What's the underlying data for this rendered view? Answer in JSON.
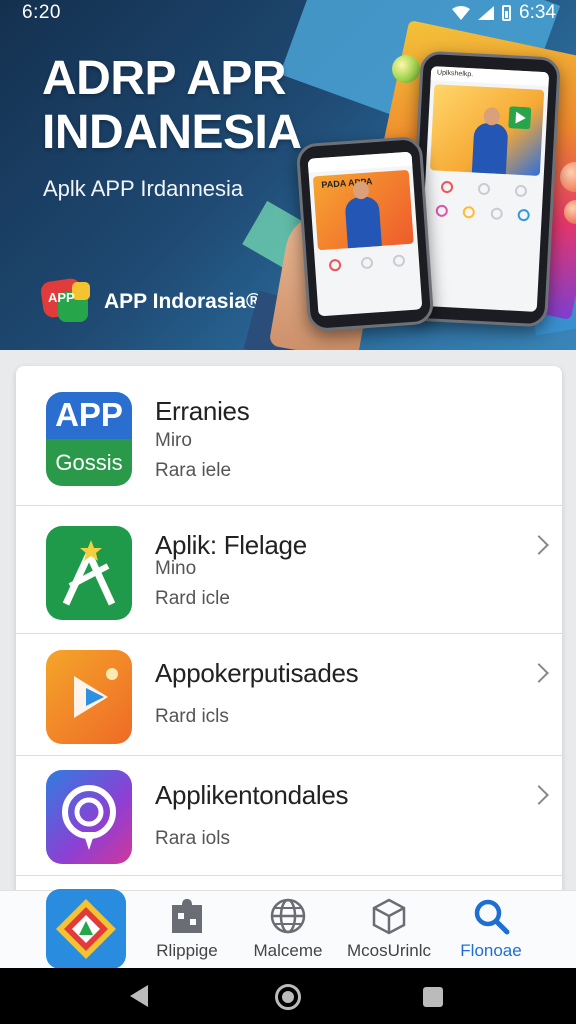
{
  "status_bar": {
    "time": "6:20",
    "right_time": "6:34"
  },
  "hero": {
    "title_line1": "ADRP APR",
    "title_line2": "INDANESIA",
    "subtitle": "Aplk APP Irdannesia",
    "brand_logo_text": "APP",
    "brand_name": "APP Indorasia®",
    "phone_bar_text": "Uplkshelkp.",
    "phone_card_text": "PADA APPA"
  },
  "apps": [
    {
      "icon_top": "APP",
      "icon_bottom": "Gossis",
      "title": "Erranies",
      "line1": "Miro",
      "line2": "Rara iele",
      "chevron": false
    },
    {
      "title": "Aplik: Flelage",
      "line1": "Mino",
      "line2": "Rard icle",
      "chevron": true
    },
    {
      "title": "Appokerputisades",
      "line1": "",
      "line2": "Rard icls",
      "chevron": true
    },
    {
      "title": "Applikentondales",
      "line1": "",
      "line2": "Rara iols",
      "chevron": true
    }
  ],
  "bottom_nav": [
    {
      "label": "Rlippige",
      "icon": "puzzle-icon"
    },
    {
      "label": "Malceme",
      "icon": "globe-icon"
    },
    {
      "label": "McosUrinlc",
      "icon": "box-icon"
    },
    {
      "label": "Flonoae",
      "icon": "search-icon",
      "active": true
    }
  ],
  "colors": {
    "accent": "#1e6fd4",
    "hero_bg": "#1f4a73"
  }
}
